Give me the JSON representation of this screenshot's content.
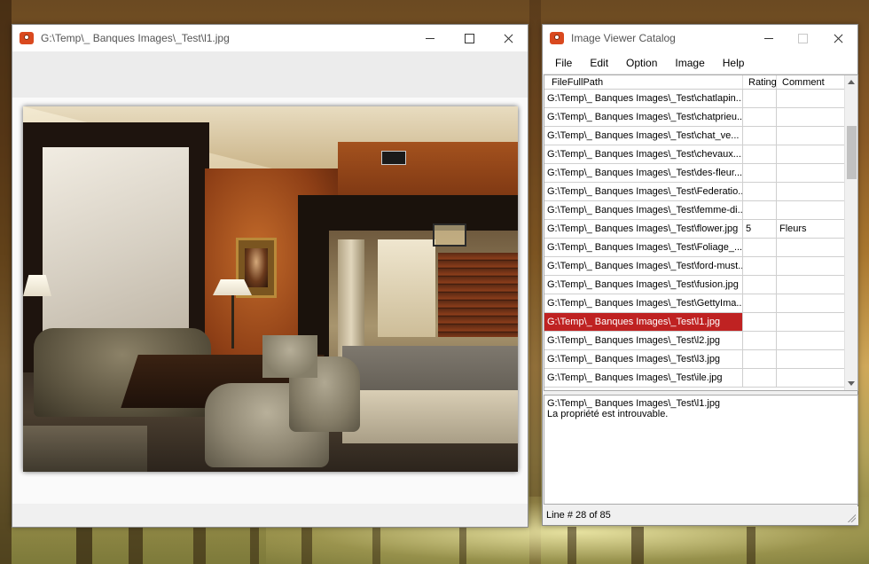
{
  "viewer": {
    "title": "G:\\Temp\\_ Banques Images\\_Test\\l1.jpg"
  },
  "catalog": {
    "title": "Image Viewer Catalog",
    "menu": [
      "File",
      "Edit",
      "Option",
      "Image",
      "Help"
    ],
    "columns": [
      "FileFullPath",
      "Rating",
      "Comment"
    ],
    "rows": [
      {
        "path": "G:\\Temp\\_ Banques Images\\_Test\\chatlapin...",
        "rating": "",
        "comment": ""
      },
      {
        "path": "G:\\Temp\\_ Banques Images\\_Test\\chatprieu...",
        "rating": "",
        "comment": ""
      },
      {
        "path": "G:\\Temp\\_ Banques Images\\_Test\\chat_ve...",
        "rating": "",
        "comment": ""
      },
      {
        "path": "G:\\Temp\\_ Banques Images\\_Test\\chevaux....",
        "rating": "",
        "comment": ""
      },
      {
        "path": "G:\\Temp\\_ Banques Images\\_Test\\des-fleur...",
        "rating": "",
        "comment": ""
      },
      {
        "path": "G:\\Temp\\_ Banques Images\\_Test\\Federatio...",
        "rating": "",
        "comment": ""
      },
      {
        "path": "G:\\Temp\\_ Banques Images\\_Test\\femme-di...",
        "rating": "",
        "comment": ""
      },
      {
        "path": "G:\\Temp\\_ Banques Images\\_Test\\flower.jpg",
        "rating": "5",
        "comment": "Fleurs"
      },
      {
        "path": "G:\\Temp\\_ Banques Images\\_Test\\Foliage_...",
        "rating": "",
        "comment": ""
      },
      {
        "path": "G:\\Temp\\_ Banques Images\\_Test\\ford-must...",
        "rating": "",
        "comment": ""
      },
      {
        "path": "G:\\Temp\\_ Banques Images\\_Test\\fusion.jpg",
        "rating": "",
        "comment": ""
      },
      {
        "path": "G:\\Temp\\_ Banques Images\\_Test\\GettyIma...",
        "rating": "",
        "comment": ""
      },
      {
        "path": "G:\\Temp\\_ Banques Images\\_Test\\l1.jpg",
        "rating": "",
        "comment": "",
        "selected": true
      },
      {
        "path": "G:\\Temp\\_ Banques Images\\_Test\\l2.jpg",
        "rating": "",
        "comment": ""
      },
      {
        "path": "G:\\Temp\\_ Banques Images\\_Test\\l3.jpg",
        "rating": "",
        "comment": ""
      },
      {
        "path": "G:\\Temp\\_ Banques Images\\_Test\\ile.jpg",
        "rating": "",
        "comment": ""
      }
    ],
    "info_line1": "G:\\Temp\\_ Banques Images\\_Test\\l1.jpg",
    "info_line2": "La propriété est introuvable.",
    "status": "Line #  28 of 85"
  },
  "colors": {
    "selection": "#bf2222",
    "app_icon": "#d9491f"
  },
  "icons": {
    "app": "camera-icon",
    "minimize": "minimize-icon",
    "maximize": "maximize-icon",
    "close": "close-icon"
  }
}
